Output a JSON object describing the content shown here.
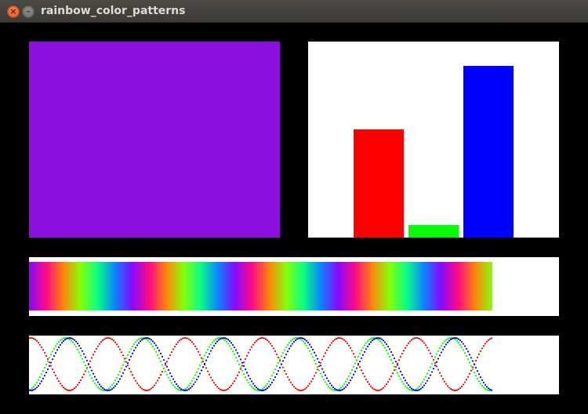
{
  "window": {
    "title": "rainbow_color_patterns"
  },
  "solid_panel": {
    "color": "#8b10e0"
  },
  "chart_data": {
    "type": "bar",
    "categories": [
      "red",
      "green",
      "blue"
    ],
    "values": [
      138,
      16,
      219
    ],
    "colors": [
      "#ff0000",
      "#00ff00",
      "#0000ff"
    ],
    "ylim": [
      0,
      250
    ]
  },
  "gradient_panel": {
    "cycles": 4.5
  },
  "wave_panel": {
    "cycles": 6,
    "colors": [
      "#ff0000",
      "#00ff00",
      "#0000ff"
    ]
  }
}
